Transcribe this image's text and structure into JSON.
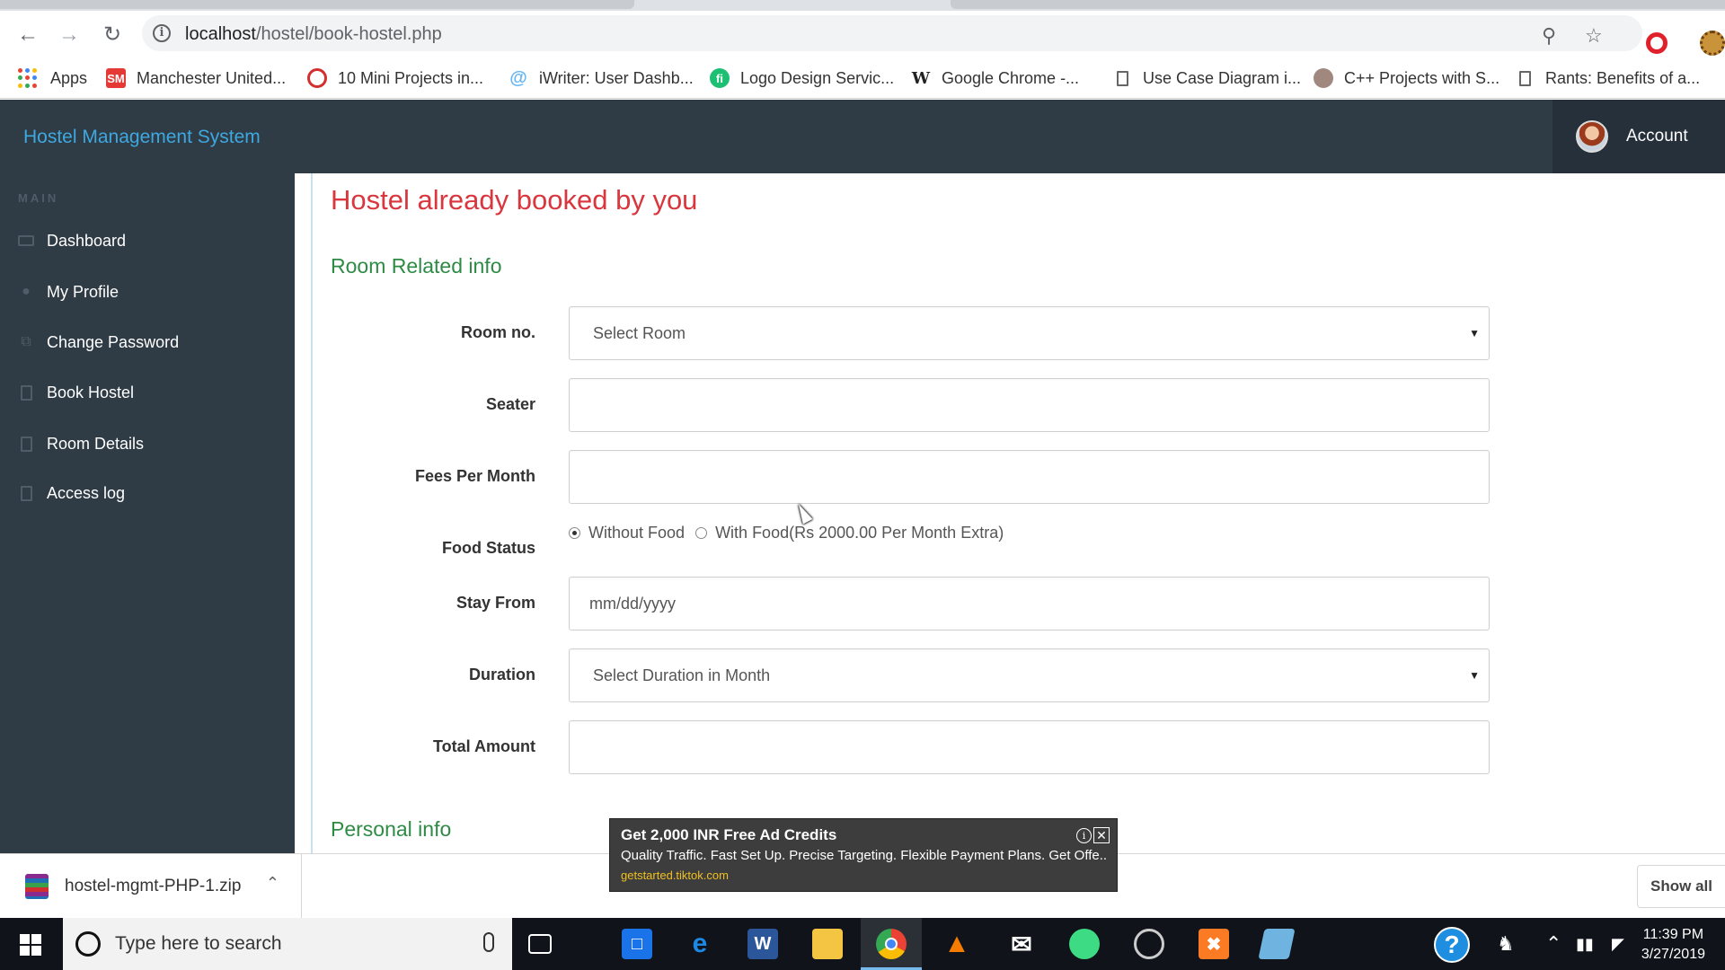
{
  "browser": {
    "url_host": "localhost",
    "url_path": "/hostel/book-hostel.php",
    "bookmarks": [
      {
        "label": "Apps",
        "icon": "apps-grid-icon"
      },
      {
        "label": "Manchester United...",
        "icon": "sm-logo-icon",
        "color": "#e53935"
      },
      {
        "label": "10 Mini Projects in...",
        "icon": "opera-logo-icon",
        "color": "#d32f2f"
      },
      {
        "label": "iWriter: User Dashb...",
        "icon": "iwriter-icon",
        "color": "#64b5f6"
      },
      {
        "label": "Logo Design Servic...",
        "icon": "fiverr-icon",
        "color": "#1dbf73"
      },
      {
        "label": "Google Chrome -...",
        "icon": "wikipedia-icon"
      },
      {
        "label": "Use Case Diagram i...",
        "icon": "page-icon"
      },
      {
        "label": "C++ Projects with S...",
        "icon": "avatar-icon"
      },
      {
        "label": "Rants: Benefits of a...",
        "icon": "page-icon"
      }
    ]
  },
  "app": {
    "brand": "Hostel Management System",
    "account_label": "Account"
  },
  "sidebar": {
    "section_label": "MAIN",
    "items": [
      {
        "label": "Dashboard",
        "icon": "monitor-icon"
      },
      {
        "label": "My Profile",
        "icon": "user-icon"
      },
      {
        "label": "Change Password",
        "icon": "copy-icon"
      },
      {
        "label": "Book Hostel",
        "icon": "file-icon"
      },
      {
        "label": "Room Details",
        "icon": "file-icon"
      },
      {
        "label": "Access log",
        "icon": "file-icon"
      }
    ]
  },
  "main": {
    "title": "Hostel already booked by you",
    "room_section": "Room Related info",
    "personal_section": "Personal info",
    "fields": {
      "room_label": "Room no.",
      "room_value": "Select Room",
      "seater_label": "Seater",
      "seater_value": "",
      "fees_label": "Fees Per Month",
      "fees_value": "",
      "food_label": "Food Status",
      "food_option_1": "Without Food",
      "food_option_2": "With Food(Rs 2000.00 Per Month Extra)",
      "food_selected": "Without Food",
      "stay_label": "Stay From",
      "stay_placeholder": "mm/dd/yyyy",
      "duration_label": "Duration",
      "duration_value": "Select Duration in Month",
      "total_label": "Total Amount",
      "total_value": ""
    }
  },
  "ad": {
    "title": "Get 2,000 INR Free Ad Credits",
    "text": "Quality Traffic. Fast Set Up. Precise Targeting. Flexible Payment Plans. Get Offe...",
    "link": "getstarted.tiktok.com"
  },
  "downloads": {
    "file_name": "hostel-mgmt-PHP-1.zip",
    "show_all": "Show all"
  },
  "taskbar": {
    "search_placeholder": "Type here to search",
    "time": "11:39 PM",
    "date": "3/27/2019"
  },
  "colors": {
    "sidebar_bg": "#2f3b45",
    "brand": "#3ea8e0",
    "title": "#d9363e",
    "section": "#2e8b45"
  }
}
